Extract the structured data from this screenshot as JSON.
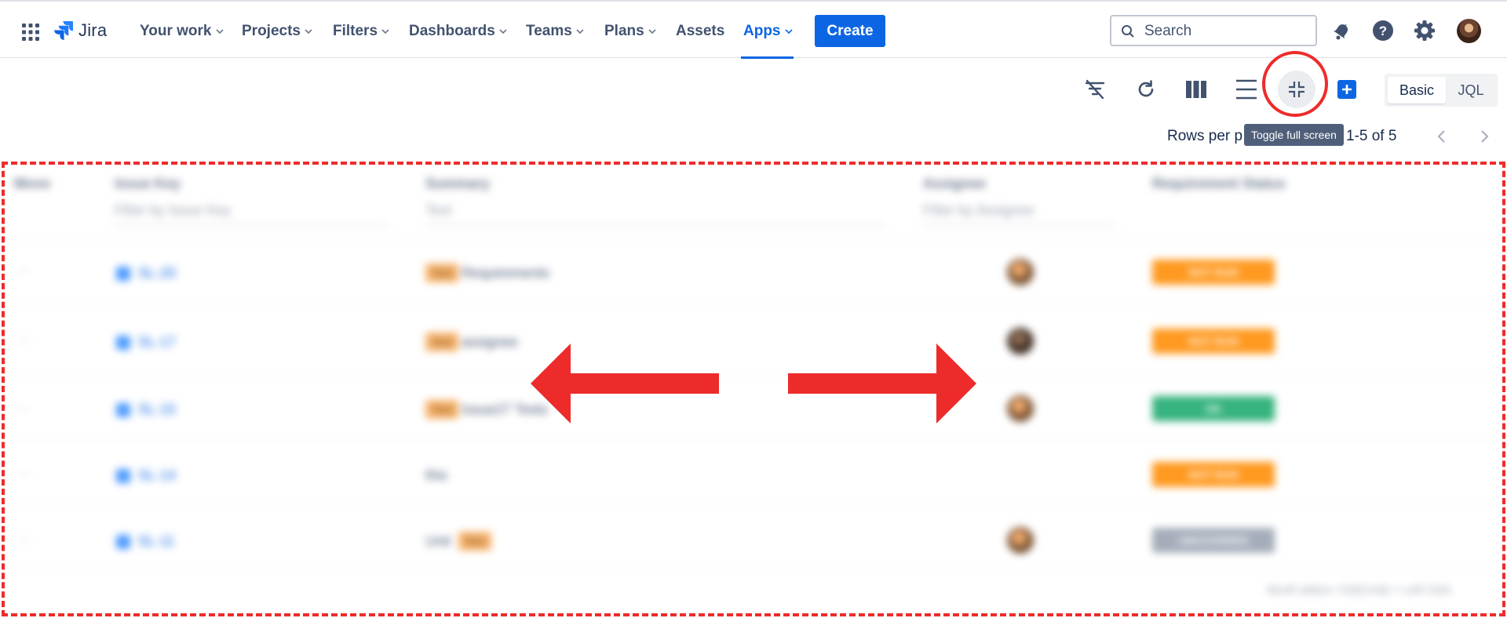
{
  "nav": {
    "app_name": "Jira",
    "items": [
      {
        "label": "Your work",
        "dropdown": true
      },
      {
        "label": "Projects",
        "dropdown": true
      },
      {
        "label": "Filters",
        "dropdown": true
      },
      {
        "label": "Dashboards",
        "dropdown": true
      },
      {
        "label": "Teams",
        "dropdown": true
      },
      {
        "label": "Plans",
        "dropdown": true
      },
      {
        "label": "Assets",
        "dropdown": false
      },
      {
        "label": "Apps",
        "dropdown": true,
        "active": true
      }
    ],
    "create_label": "Create",
    "search_placeholder": "Search",
    "icons": [
      "app-switcher-icon",
      "notifications-icon",
      "help-icon",
      "settings-icon",
      "user-avatar"
    ]
  },
  "toolbar": {
    "icons": [
      "clear-filters-icon",
      "refresh-icon",
      "columns-icon",
      "density-icon",
      "toggle-full-screen-icon",
      "add-icon"
    ],
    "tooltip": "Toggle full screen",
    "search_modes": [
      "Basic",
      "JQL"
    ],
    "active_search_mode": "Basic"
  },
  "pagination": {
    "rows_per_page_label": "Rows per p",
    "range_label": "1-5 of 5"
  },
  "table": {
    "headers": [
      "Move",
      "Issue Key",
      "Summary",
      "Assignee",
      "Requirement Status"
    ],
    "filter_placeholders": [
      "Filter by Issue Key",
      "Text",
      "Filter by Assignee"
    ],
    "rows": [
      {
        "move": "···",
        "key": "SL-20",
        "tag": "Test",
        "summary": "Requirements",
        "assignee": true,
        "status": "NOT RUN",
        "status_color": "#FF991F"
      },
      {
        "move": "···",
        "key": "SL-17",
        "tag": "Test",
        "summary": "assignee",
        "assignee": true,
        "status": "NOT RUN",
        "status_color": "#FF991F"
      },
      {
        "move": "···",
        "key": "SL-15",
        "tag": "Test",
        "summary": "Issue27 Tests",
        "assignee": true,
        "status": "OK",
        "status_color": "#36B37E"
      },
      {
        "move": "···",
        "key": "SL-14",
        "tag": "",
        "summary": "this",
        "assignee": false,
        "status": "NOT RUN",
        "status_color": "#FF991F"
      },
      {
        "move": "···",
        "key": "SL-11",
        "tag": "Test",
        "summary": "Unit",
        "assignee": true,
        "status": "UNCOVERED",
        "status_color": "#A5ADBA"
      }
    ],
    "footer": "Moofi addon: Ctrl(Cmd) + Left Click"
  },
  "colors": {
    "accent": "#0C66E4",
    "annotation_red": "#EE2B2B"
  }
}
